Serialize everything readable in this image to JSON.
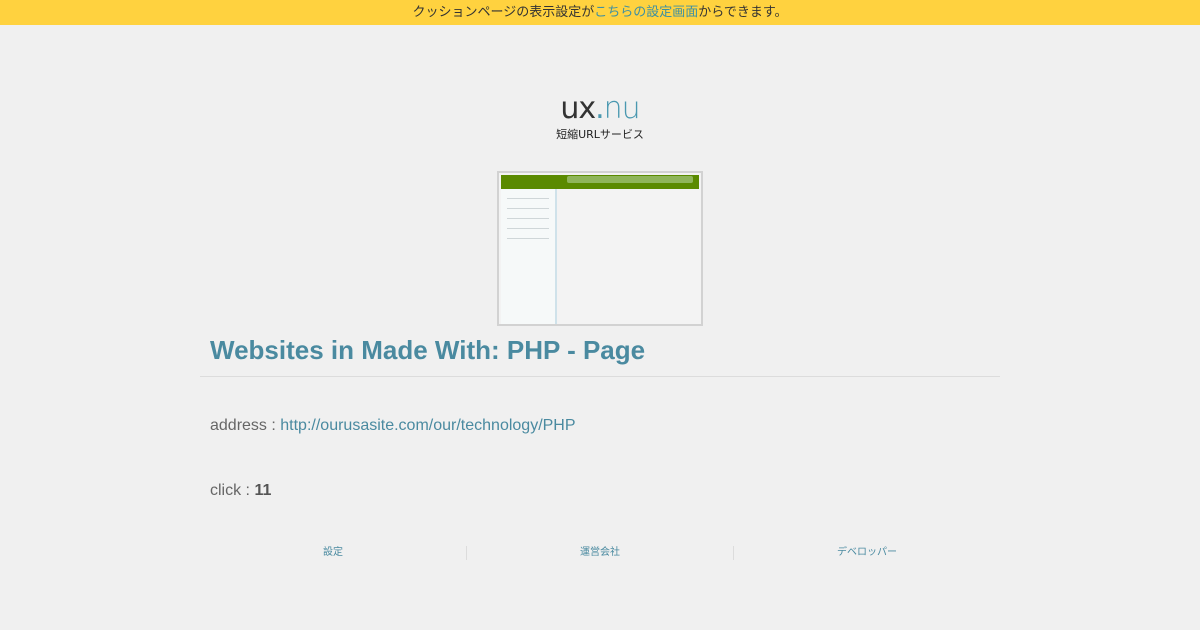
{
  "notice": {
    "before": "クッションページの表示設定が",
    "link": "こちらの設定画面",
    "after": "からできます。"
  },
  "logo": {
    "ux": "ux",
    "dot": ".",
    "nu": "nu",
    "tagline": "短縮URLサービス"
  },
  "preview": {
    "alt": "ourusasite screenshot thumbnail"
  },
  "page": {
    "title": "Websites in Made With: PHP - Page",
    "address_label": "address : ",
    "address_url": "http://ourusasite.com/our/technology/PHP",
    "click_label": "click : ",
    "click_count": "11"
  },
  "footer": {
    "links": [
      "設定",
      "運営会社",
      "デベロッパー"
    ]
  },
  "colors": {
    "banner": "#ffd23f",
    "accent": "#4a8aa0",
    "background": "#f0f0f0"
  }
}
